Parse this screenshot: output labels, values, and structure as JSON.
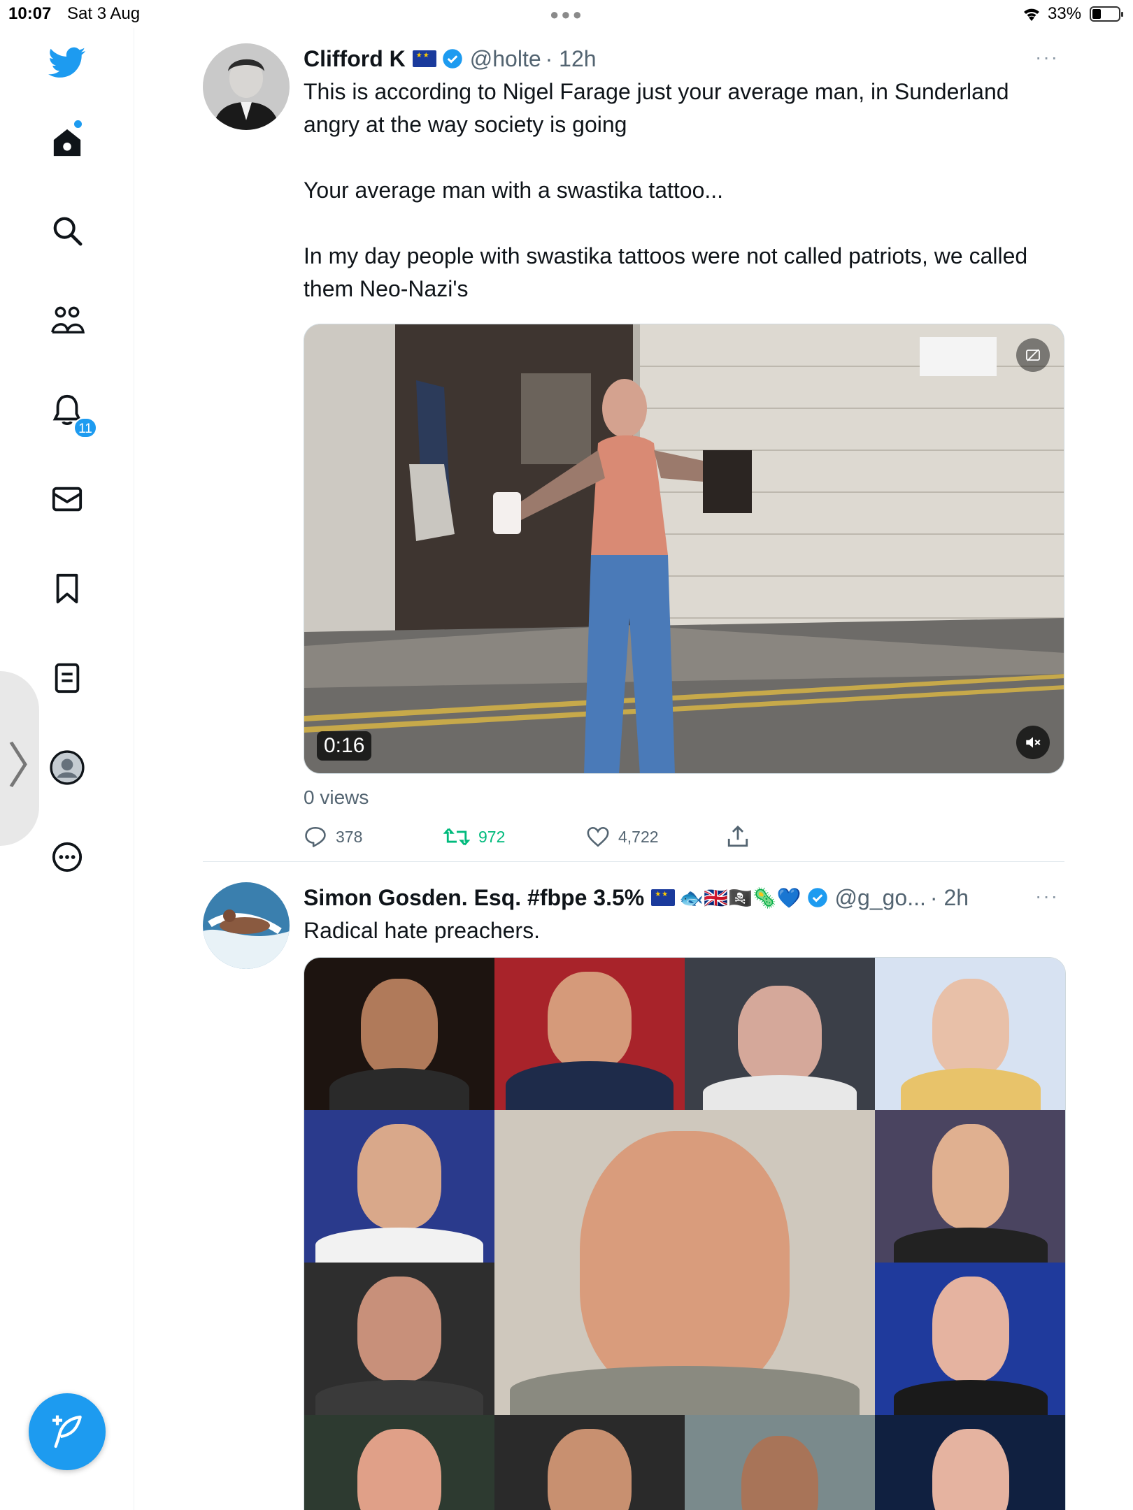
{
  "status_bar": {
    "time": "10:07",
    "date": "Sat 3 Aug",
    "battery": "33%",
    "battery_level": 0.33
  },
  "sidebar": {
    "items": [
      {
        "name": "twitter-logo-icon"
      },
      {
        "name": "home-icon"
      },
      {
        "name": "search-icon"
      },
      {
        "name": "communities-icon"
      },
      {
        "name": "notifications-icon"
      },
      {
        "name": "messages-icon"
      },
      {
        "name": "bookmarks-icon"
      },
      {
        "name": "lists-icon"
      },
      {
        "name": "profile-icon"
      },
      {
        "name": "more-icon"
      }
    ],
    "notifications_badge": "11",
    "accent_color": "#1d9bf0"
  },
  "tweets": [
    {
      "name": "Clifford K",
      "handle": "@holte",
      "time": "· 12h",
      "text": "This is according to Nigel Farage just your average man, in Sunderland angry at the way society is going\n\nYour average man with a swastika tattoo...\n\nIn my day people with swastika tattoos were not called patriots, we called them Neo-Nazi's",
      "video_duration": "0:16",
      "views": "0 views",
      "replies": "378",
      "retweets": "972",
      "likes": "4,722"
    },
    {
      "name": "Simon Gosden. Esq. #fbpe 3.5%",
      "emoji": "🐟🇬🇧🏴‍☠️🦠💙",
      "handle": "@g_go...",
      "time": "· 2h",
      "text": "Radical hate preachers."
    }
  ]
}
